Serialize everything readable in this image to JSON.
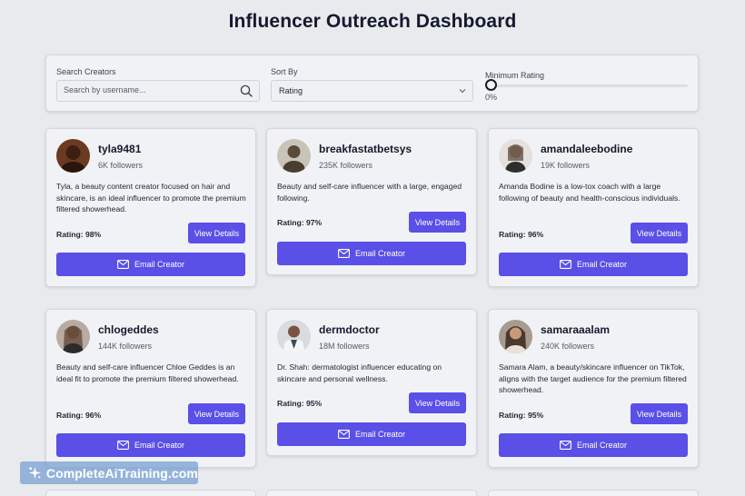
{
  "header": {
    "title": "Influencer Outreach Dashboard"
  },
  "filters": {
    "search_label": "Search Creators",
    "search_placeholder": "Search by username...",
    "sort_label": "Sort By",
    "sort_value": "Rating",
    "rating_label": "Minimum Rating",
    "rating_value": "0%",
    "rating_level": 0
  },
  "buttons": {
    "view_details": "View Details",
    "email_creator": "Email Creator"
  },
  "creators": [
    {
      "username": "tyla9481",
      "followers": "6K followers",
      "description": "Tyla, a beauty content creator focused on hair and skincare, is an ideal influencer to promote the premium filtered showerhead.",
      "rating": "Rating: 98%",
      "avatar_color": "#6b3a22"
    },
    {
      "username": "breakfastatbetsys",
      "followers": "235K followers",
      "description": "Beauty and self-care influencer with a large, engaged following.",
      "rating": "Rating: 97%",
      "avatar_color": "#5a4a3a"
    },
    {
      "username": "amandaleebodine",
      "followers": "19K followers",
      "description": "Amanda Bodine is a low-tox coach with a large following of beauty and health-conscious individuals.",
      "rating": "Rating: 96%",
      "avatar_color": "#c7a68a"
    },
    {
      "username": "chlogeddes",
      "followers": "144K followers",
      "description": "Beauty and self-care influencer Chloe Geddes is an ideal fit to promote the premium filtered showerhead.",
      "rating": "Rating: 96%",
      "avatar_color": "#8a6f5c"
    },
    {
      "username": "dermdoctor",
      "followers": "18M followers",
      "description": "Dr. Shah: dermatologist influencer educating on skincare and personal wellness.",
      "rating": "Rating: 95%",
      "avatar_color": "#3b4a66"
    },
    {
      "username": "samaraaalam",
      "followers": "240K followers",
      "description": "Samara Alam, a beauty/skincare influencer on TikTok, aligns with the target audience for the premium filtered showerhead.",
      "rating": "Rating: 95%",
      "avatar_color": "#4a3a30"
    }
  ],
  "watermark": {
    "text": "CompleteAiTraining.com"
  },
  "colors": {
    "accent": "#5a4fe6",
    "background": "#e9eaee",
    "card": "#f1f2f5"
  }
}
